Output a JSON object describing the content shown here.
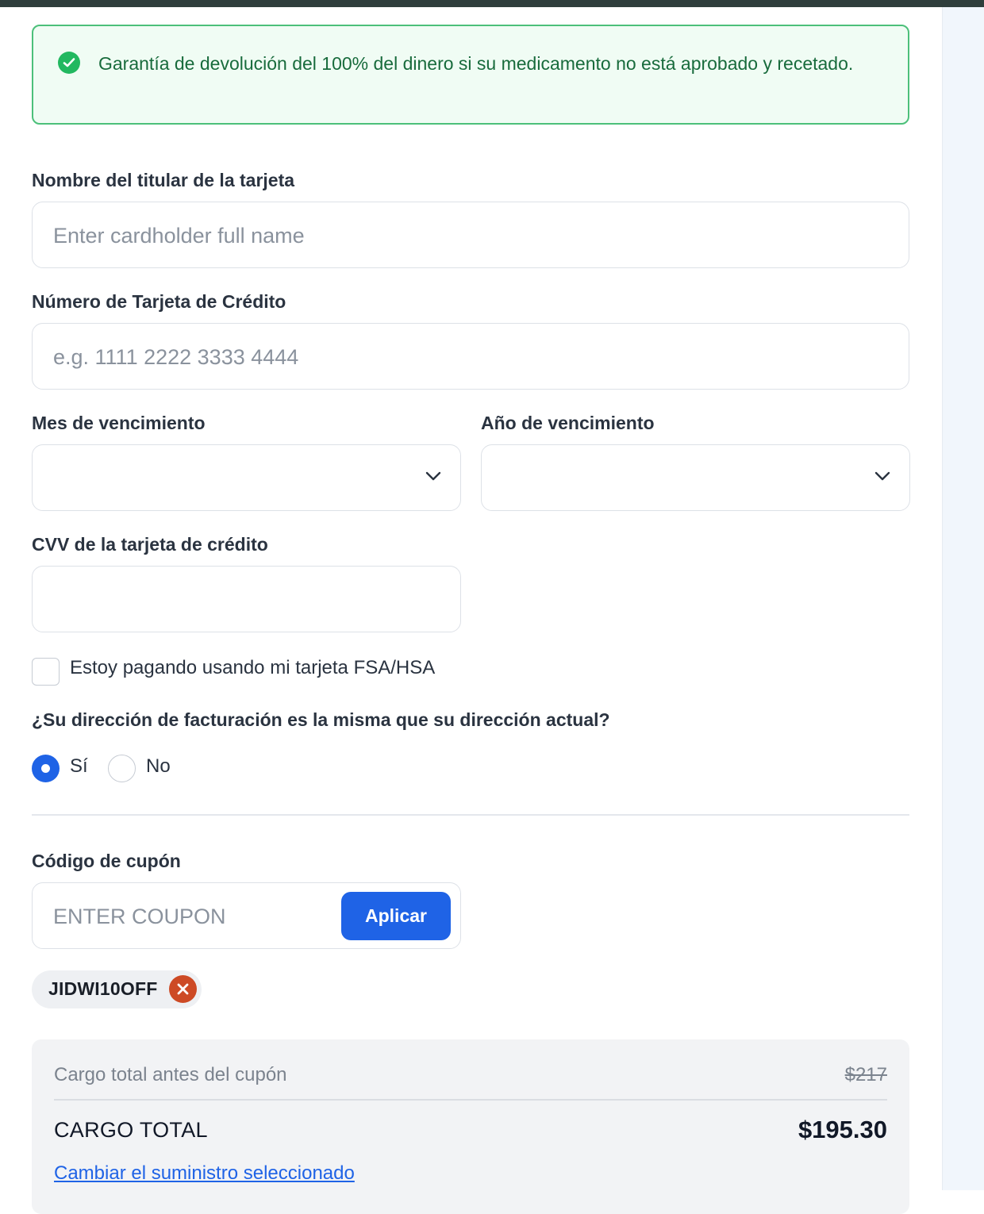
{
  "guarantee": {
    "text": "Garantía de devolución del 100% del dinero si su medicamento no está aprobado y recetado."
  },
  "cardholder": {
    "label": "Nombre del titular de la tarjeta",
    "placeholder": "Enter cardholder full name",
    "value": ""
  },
  "card_number": {
    "label": "Número de Tarjeta de Crédito",
    "placeholder": "e.g. 1111 2222 3333 4444",
    "value": ""
  },
  "expiry_month": {
    "label": "Mes de vencimiento",
    "value": ""
  },
  "expiry_year": {
    "label": "Año de vencimiento",
    "value": ""
  },
  "cvv": {
    "label": "CVV de la tarjeta de crédito",
    "value": ""
  },
  "fsa_checkbox": {
    "label": "Estoy pagando usando mi tarjeta FSA/HSA",
    "checked": false
  },
  "billing_address": {
    "question": "¿Su dirección de facturación es la misma que su dirección actual?",
    "options": [
      "Sí",
      "No"
    ],
    "selected": "Sí"
  },
  "coupon": {
    "label": "Código de cupón",
    "placeholder": "ENTER COUPON",
    "apply_label": "Aplicar",
    "applied_code": "JIDWI10OFF"
  },
  "summary": {
    "before_label": "Cargo total antes del cupón",
    "before_value": "$217",
    "total_label": "CARGO TOTAL",
    "total_value": "$195.30",
    "change_link": "Cambiar el suministro seleccionado"
  },
  "colors": {
    "primary": "#1f63e6",
    "success": "#22b860",
    "danger": "#cd4a25"
  }
}
